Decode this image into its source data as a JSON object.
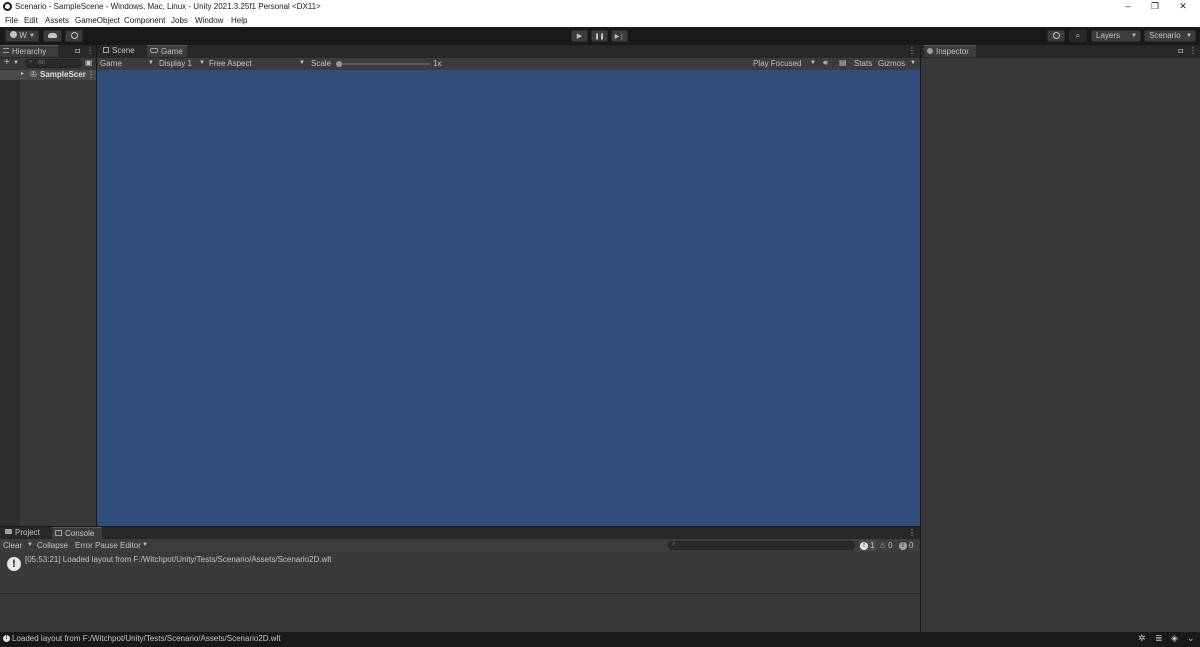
{
  "window": {
    "title": "Scenario - SampleScene - Windows, Mac, Linux - Unity 2021.3.25f1 Personal <DX11>",
    "minimize": "–",
    "maximize": "❐",
    "close": "✕"
  },
  "menu": {
    "items": [
      "File",
      "Edit",
      "Assets",
      "GameObject",
      "Component",
      "Jobs",
      "Window",
      "Help"
    ]
  },
  "toolbar": {
    "account_label": "W",
    "play_icon": "▶",
    "pause_icon": "❚❚",
    "step_icon": "▶❘",
    "layers_label": "Layers",
    "layout_label": "Scenario"
  },
  "hierarchy": {
    "tab_label": "Hierarchy",
    "add_label": "+",
    "search_placeholder": "All",
    "scene_item": "SampleScer"
  },
  "game": {
    "tabs": [
      {
        "label": "Scene"
      },
      {
        "label": "Game"
      }
    ],
    "view_dropdown": "Game",
    "display_dropdown": "Display 1",
    "aspect_dropdown": "Free Aspect",
    "scale_label": "Scale",
    "scale_value": "1x",
    "play_focused": "Play Focused",
    "stats_label": "Stats",
    "gizmos_label": "Gizmos",
    "background_color": "#314d79"
  },
  "inspector": {
    "tab_label": "Inspector"
  },
  "bottom": {
    "tabs": [
      {
        "label": "Project"
      },
      {
        "label": "Console"
      }
    ],
    "clear_label": "Clear",
    "collapse_label": "Collapse",
    "error_pause_label": "Error Pause",
    "editor_label": "Editor",
    "info_count": "1",
    "warning_count": "0",
    "error_count": "0",
    "log_message": "[05:53:21] Loaded layout from F:/Witchpot/Unity/Tests/Scenario/Assets/Scenario2D.wlt"
  },
  "status": {
    "message": "Loaded layout from F:/Witchpot/Unity/Tests/Scenario/Assets/Scenario2D.wlt"
  }
}
